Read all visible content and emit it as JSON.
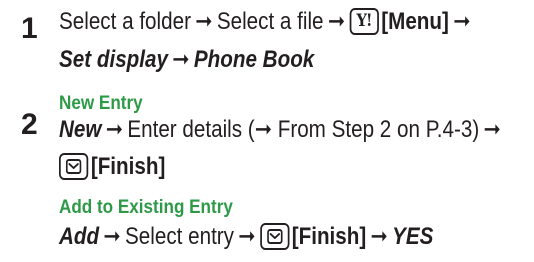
{
  "step1": {
    "number": "1",
    "part1": "Select a folder",
    "arrow1": "➞",
    "part2": "Select a file",
    "arrow2": "➞",
    "key_label": "Y!",
    "menu_label": "[Menu]",
    "arrow3": "➞",
    "part3": "Set display",
    "arrow4": "➞",
    "part4": "Phone Book"
  },
  "step2": {
    "number": "2",
    "new_entry": {
      "heading": "New Entry",
      "action": "New",
      "arrow1": "➞",
      "text": "Enter details (",
      "arrow2": "➞",
      "ref": " From Step 2 on P.4-3)",
      "arrow3": "➞",
      "finish_label": "[Finish]"
    },
    "existing_entry": {
      "heading": "Add to Existing Entry",
      "action": "Add",
      "arrow1": "➞",
      "text": "Select entry",
      "arrow2": "➞",
      "finish_label": "[Finish]",
      "arrow3": "➞",
      "confirm": "YES"
    }
  },
  "icons": {
    "yahoo_key": "yahoo-key-icon",
    "mail_key": "mail-key-icon"
  },
  "colors": {
    "text": "#231f20",
    "heading_green": "#2e9a48"
  }
}
